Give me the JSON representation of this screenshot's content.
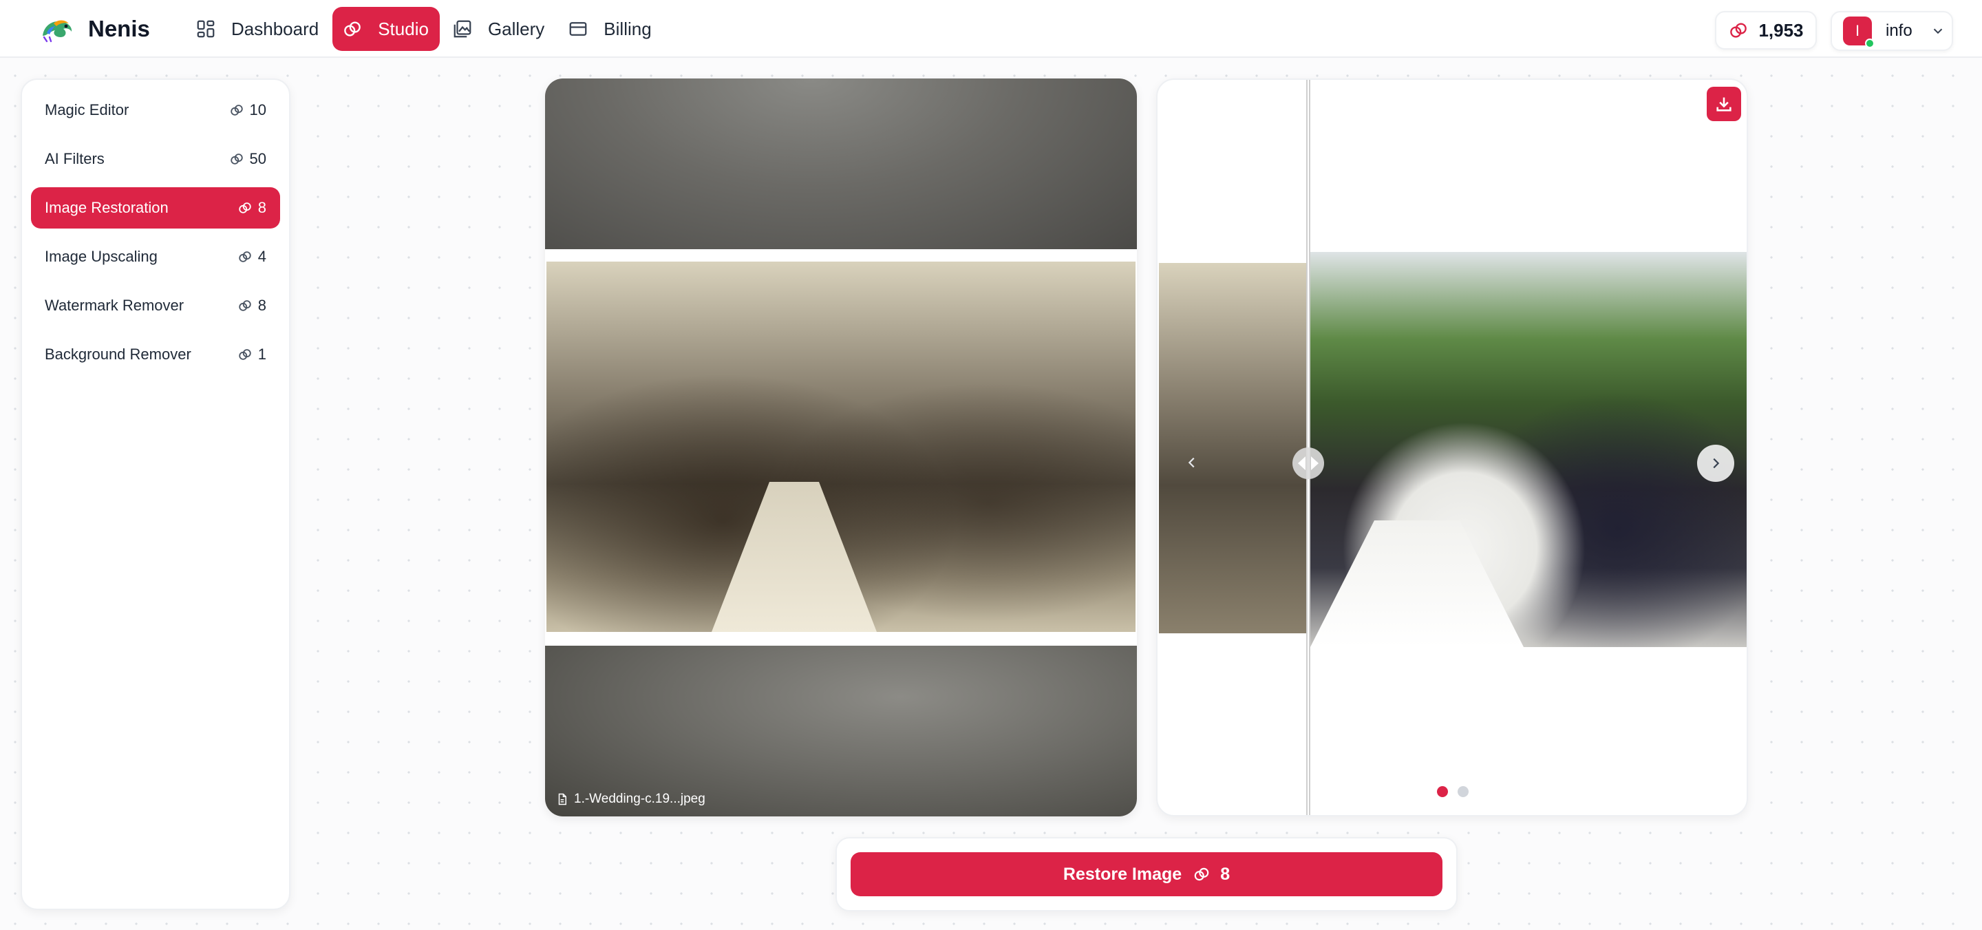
{
  "brand": {
    "name": "Nenis"
  },
  "nav": [
    {
      "label": "Dashboard",
      "icon": "dashboard-icon",
      "active": false
    },
    {
      "label": "Studio",
      "icon": "studio-icon",
      "active": true
    },
    {
      "label": "Gallery",
      "icon": "gallery-icon",
      "active": false
    },
    {
      "label": "Billing",
      "icon": "billing-icon",
      "active": false
    }
  ],
  "credits": {
    "balance": "1,953",
    "icon": "credits-icon"
  },
  "user": {
    "initial": "I",
    "name": "info",
    "status_color": "#22c55e"
  },
  "tools": [
    {
      "label": "Magic Editor",
      "cost": "10",
      "active": false
    },
    {
      "label": "AI Filters",
      "cost": "50",
      "active": false
    },
    {
      "label": "Image Restoration",
      "cost": "8",
      "active": true
    },
    {
      "label": "Image Upscaling",
      "cost": "4",
      "active": false
    },
    {
      "label": "Watermark Remover",
      "cost": "8",
      "active": false
    },
    {
      "label": "Background Remover",
      "cost": "1",
      "active": false
    }
  ],
  "preview": {
    "file_name": "1.-Wedding-c.19...jpeg"
  },
  "comparison": {
    "slides": 2,
    "active_slide": 1
  },
  "action": {
    "label": "Restore Image",
    "cost": "8"
  },
  "colors": {
    "accent": "#dc2347",
    "text": "#1f2937",
    "muted": "#d1d5db"
  }
}
